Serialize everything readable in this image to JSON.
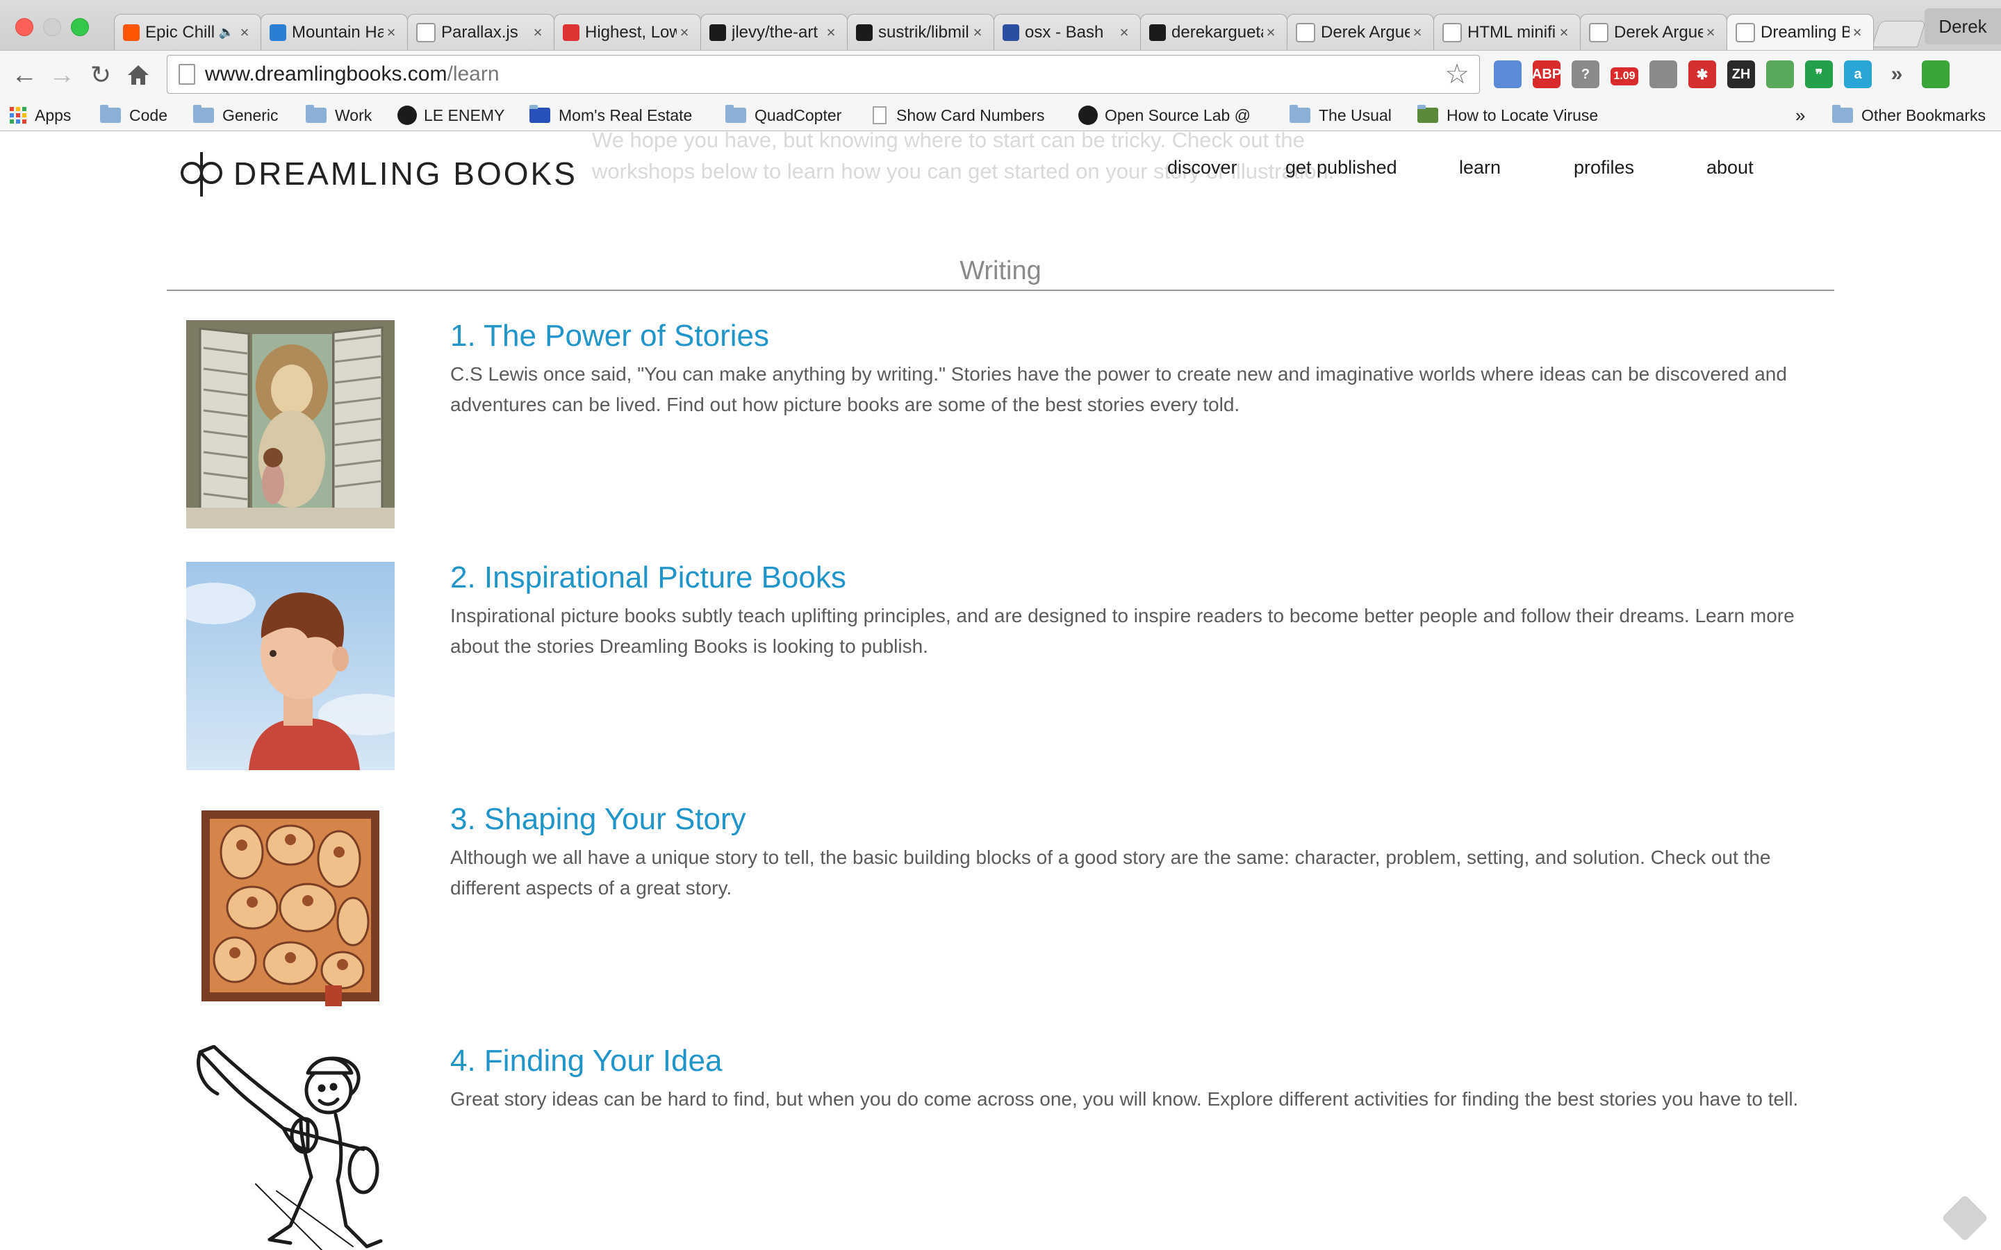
{
  "browser": {
    "tabs": [
      {
        "title": "Epic Chill",
        "icon": "soundcloud-icon",
        "color": "#ff5500",
        "audio": true
      },
      {
        "title": "Mountain Hardwear",
        "icon": "mountain-icon",
        "color": "#2a7fd4"
      },
      {
        "title": "Parallax.js",
        "icon": "page-icon",
        "color": "#ffffff"
      },
      {
        "title": "Highest, Lowest",
        "icon": "rainbow-icon",
        "color": "#d33"
      },
      {
        "title": "jlevy/the-art",
        "icon": "github-icon",
        "color": "#1b1b1b"
      },
      {
        "title": "sustrik/libmill",
        "icon": "github-icon",
        "color": "#1b1b1b"
      },
      {
        "title": "osx - Bash",
        "icon": "unix-linux-icon",
        "color": "#2b4fa0"
      },
      {
        "title": "derekargueta",
        "icon": "github-icon",
        "color": "#1b1b1b"
      },
      {
        "title": "Derek Argueta",
        "icon": "page-icon",
        "color": "#ffffff"
      },
      {
        "title": "HTML minifier",
        "icon": "page-icon",
        "color": "#ffffff"
      },
      {
        "title": "Derek Argueta",
        "icon": "page-icon",
        "color": "#ffffff"
      },
      {
        "title": "Dreamling Books",
        "icon": "dreamling-icon",
        "color": "#ffffff",
        "active": true
      }
    ],
    "close_glyph": "×",
    "user_name": "Derek",
    "address": {
      "host": "www.dreamlingbooks.com",
      "path": "/learn"
    },
    "extensions": [
      {
        "name": "calendar-extension-icon",
        "label": "",
        "color": "#5b8ad6"
      },
      {
        "name": "adblock-plus-icon",
        "label": "ABP",
        "color": "#d92b2b"
      },
      {
        "name": "question-extension-icon",
        "label": "?",
        "color": "#8a8a8a"
      },
      {
        "name": "speed-badge-icon",
        "label": "1.09",
        "color": "#d92b2b"
      },
      {
        "name": "screenshot-extension-icon",
        "label": "",
        "color": "#8a8a8a"
      },
      {
        "name": "lastpass-icon",
        "label": "✱",
        "color": "#d32f2f"
      },
      {
        "name": "zh-extension-icon",
        "label": "ZH",
        "color": "#2a2a2a"
      },
      {
        "name": "pocket-extension-icon",
        "label": "",
        "color": "#5aa85a"
      },
      {
        "name": "hangouts-icon",
        "label": "❞",
        "color": "#23a04a"
      },
      {
        "name": "amazon-assistant-icon",
        "label": "a",
        "color": "#2aa6d6"
      },
      {
        "name": "overflow-chevron-icon",
        "label": "»",
        "color": "#555555"
      },
      {
        "name": "chrome-menu-icon",
        "label": "",
        "color": "#3aa63a"
      }
    ]
  },
  "bookmarks": [
    {
      "label": "Apps",
      "kind": "apps"
    },
    {
      "label": "Code",
      "kind": "folder"
    },
    {
      "label": "Generic",
      "kind": "folder"
    },
    {
      "label": "Work",
      "kind": "folder"
    },
    {
      "label": "LE ENEMY",
      "kind": "github"
    },
    {
      "label": "Mom's Real Estate",
      "kind": "realestate"
    },
    {
      "label": "QuadCopter",
      "kind": "folder"
    },
    {
      "label": "Show Card Numbers",
      "kind": "file"
    },
    {
      "label": "Open Source Lab @",
      "kind": "github"
    },
    {
      "label": "The Usual",
      "kind": "folder"
    },
    {
      "label": "How to Locate Viruse",
      "kind": "wh"
    },
    {
      "label": "»",
      "kind": "overflow"
    },
    {
      "label": "Other Bookmarks",
      "kind": "folder"
    }
  ],
  "site": {
    "logo_text": "DREAMLING BOOKS",
    "ghost_text": "We hope you have, but knowing where to start can be tricky. Check out the workshops below to learn how you can get started on your story or illustration.",
    "nav": [
      "discover",
      "get published",
      "learn",
      "profiles",
      "about"
    ],
    "section_title": "Writing",
    "items": [
      {
        "title": "1. The Power of Stories",
        "description": "C.S Lewis once said, \"You can make anything by writing.\" Stories have the power to create new and imaginative worlds where ideas can be discovered and adventures can be lived. Find out how picture books are some of the best stories every told."
      },
      {
        "title": "2. Inspirational Picture Books",
        "description": "Inspirational picture books subtly teach uplifting principles, and are designed to inspire readers to become better people and follow their dreams. Learn more about the stories Dreamling Books is looking to publish."
      },
      {
        "title": "3. Shaping Your Story",
        "description": "Although we all have a unique story to tell, the basic building blocks of a good story are the same: character, problem, setting, and solution. Check out the different aspects of a great story."
      },
      {
        "title": "4. Finding Your Idea",
        "description": "Great story ideas can be hard to find, but when you do come across one, you will know. Explore different activities for finding the best stories you have to tell."
      }
    ]
  }
}
